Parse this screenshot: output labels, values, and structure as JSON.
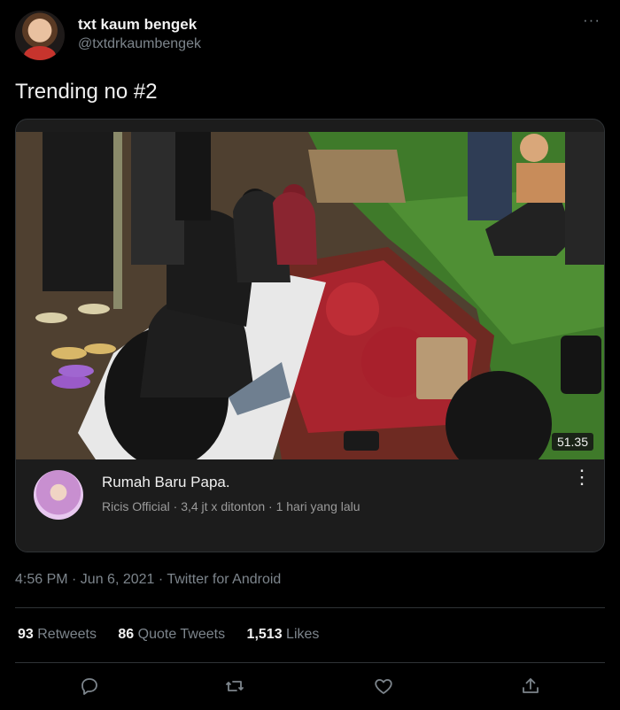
{
  "user": {
    "name": "txt kaum bengek",
    "handle": "@txtdrkaumbengek"
  },
  "tweet": {
    "text": "Trending no #2"
  },
  "card": {
    "duration": "51.35",
    "title": "Rumah Baru Papa.",
    "meta": "Ricis Official · 3,4 jt x ditonton · 1 hari yang lalu"
  },
  "timestamp": "4:56 PM · Jun 6, 2021 · Twitter for Android",
  "stats": {
    "retweets_count": "93",
    "retweets_label": "Retweets",
    "quotes_count": "86",
    "quotes_label": "Quote Tweets",
    "likes_count": "1,513",
    "likes_label": "Likes"
  },
  "icons": {
    "more": "more-horizontal-icon",
    "reply": "reply-icon",
    "retweet": "retweet-icon",
    "like": "heart-icon",
    "share": "share-icon"
  },
  "colors": {
    "background": "#000000",
    "secondary_text": "#7d858c",
    "divider": "#2f3336"
  }
}
